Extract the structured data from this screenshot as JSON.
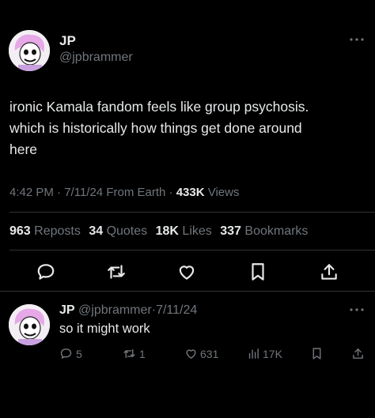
{
  "tweet": {
    "author_name": "JP",
    "author_handle": "@jpbrammer",
    "more_icon": "more-horizontal-icon",
    "text_line1": "ironic Kamala fandom feels like group psychosis.",
    "text_line2": "which is historically how things get done around",
    "text_line3": "here",
    "time": "4:42 PM",
    "sep1": "·",
    "date": "7/11/24",
    "source": "From Earth",
    "sep2": "·",
    "views_count": "433K",
    "views_label": "Views",
    "reposts_count": "963",
    "reposts_label": "Reposts",
    "quotes_count": "34",
    "quotes_label": "Quotes",
    "likes_count": "18K",
    "likes_label": "Likes",
    "bookmarks_count": "337",
    "bookmarks_label": "Bookmarks"
  },
  "reply": {
    "author_name": "JP",
    "author_handle": "@jpbrammer",
    "sep": "·",
    "date": "7/11/24",
    "text": "so it might work",
    "replies": "5",
    "reposts": "1",
    "likes": "631",
    "views": "17K"
  },
  "colors": {
    "background": "#000000",
    "text": "#e7e9ea",
    "muted": "#71767b",
    "divider": "#2f3336",
    "avatar_hair": "#e6a8e6"
  }
}
